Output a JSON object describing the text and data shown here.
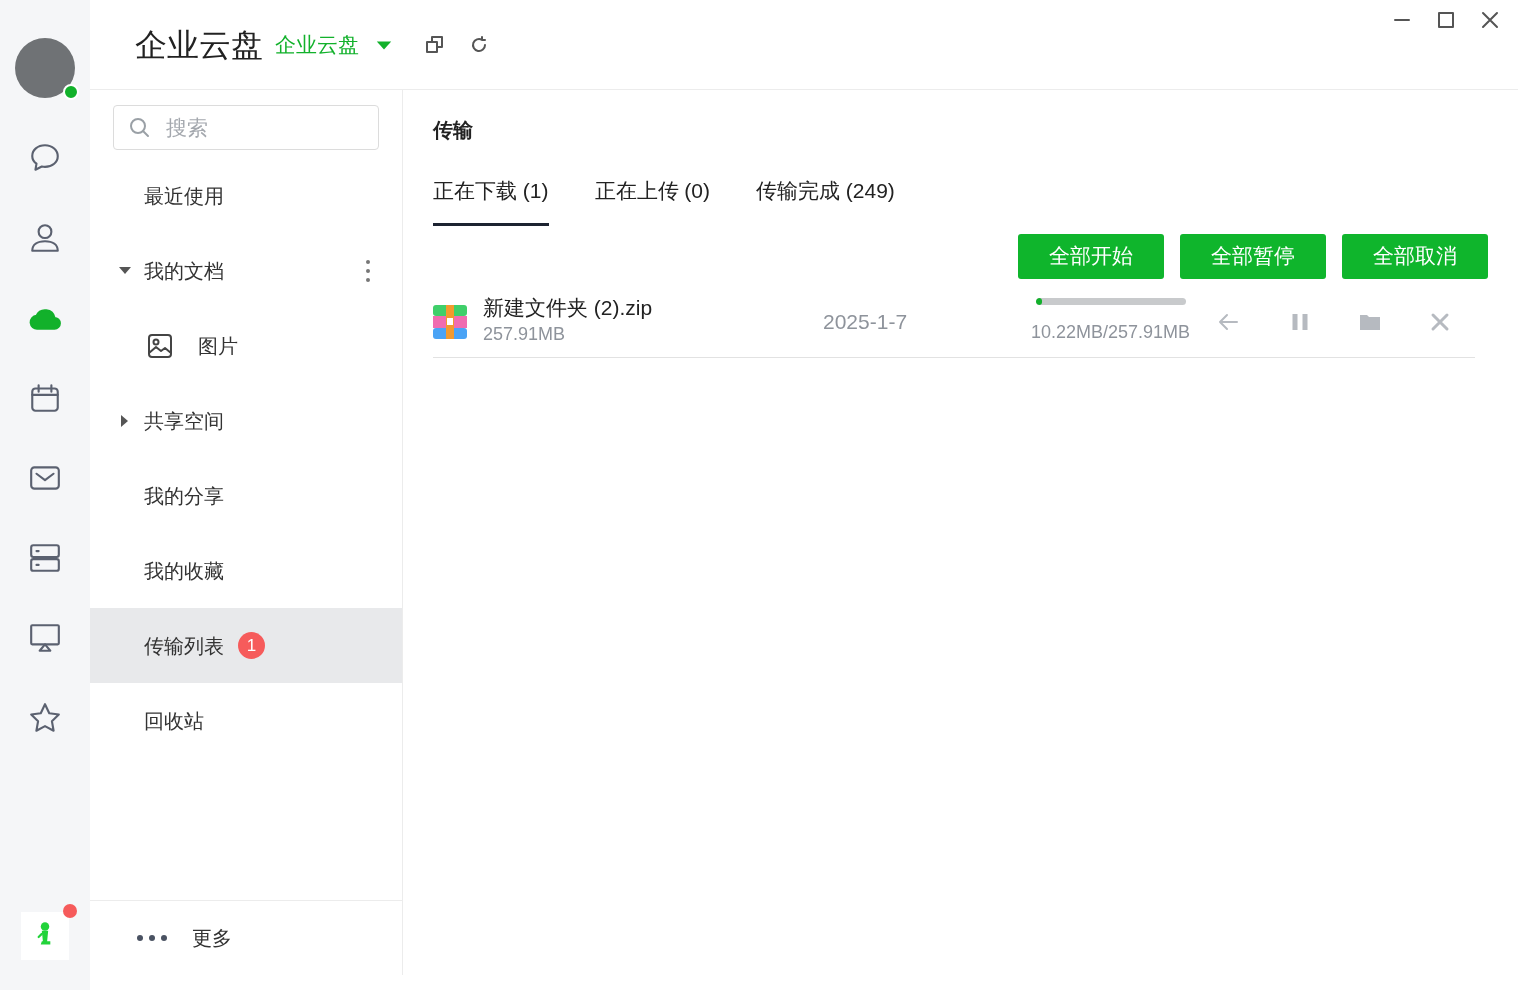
{
  "rail": {
    "avatar_online": true,
    "items": [
      {
        "kind": "chat",
        "selected": false
      },
      {
        "kind": "person",
        "selected": false
      },
      {
        "kind": "cloud",
        "selected": true
      },
      {
        "kind": "calendar",
        "selected": false
      },
      {
        "kind": "mail",
        "selected": false
      },
      {
        "kind": "server",
        "selected": false
      },
      {
        "kind": "screen",
        "selected": false
      },
      {
        "kind": "star",
        "selected": false
      }
    ],
    "app_notification": true
  },
  "header": {
    "title": "企业云盘",
    "space": "企业云盘"
  },
  "sidebar": {
    "search": {
      "placeholder": "搜索"
    },
    "items": [
      {
        "kind": "link",
        "label": "最近使用",
        "selected": false
      },
      {
        "kind": "group",
        "label": "我的文档",
        "expanded": true,
        "menu": true,
        "selected": false,
        "children": [
          {
            "kind": "image",
            "label": "图片",
            "selected": false
          }
        ]
      },
      {
        "kind": "group",
        "label": "共享空间",
        "expanded": false,
        "menu": false,
        "selected": false
      },
      {
        "kind": "link",
        "label": "我的分享",
        "selected": false
      },
      {
        "kind": "link",
        "label": "我的收藏",
        "selected": false
      },
      {
        "kind": "link",
        "label": "传输列表",
        "selected": true,
        "badge": "1"
      },
      {
        "kind": "link",
        "label": "回收站",
        "selected": false
      }
    ],
    "more": "更多"
  },
  "content": {
    "title": "传输",
    "tabs": [
      {
        "label": "正在下载 (1)",
        "selected": true
      },
      {
        "label": "正在上传 (0)",
        "selected": false
      },
      {
        "label": "传输完成 (249)",
        "selected": false
      }
    ],
    "buttons": [
      "全部开始",
      "全部暂停",
      "全部取消"
    ],
    "rows": [
      {
        "name": "新建文件夹 (2).zip",
        "size": "257.91MB",
        "date": "2025-1-7",
        "level": 0.04,
        "progress_text": "10.22MB/257.91MB"
      }
    ]
  }
}
